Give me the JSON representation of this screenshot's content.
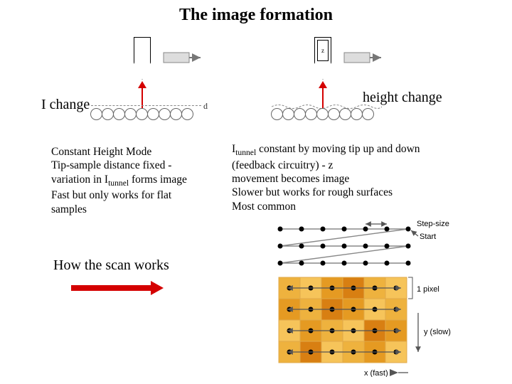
{
  "title": "The image formation",
  "labels": {
    "i_change": "I change",
    "height_change": "height change",
    "how_scan": "How the scan works",
    "d": "d",
    "z": "z",
    "step_size": "Step-size",
    "start": "Start",
    "one_pixel": "1 pixel",
    "y_slow": "y (slow)",
    "x_fast": "x (fast)"
  },
  "left_mode": {
    "line1": "Constant Height Mode",
    "line2": "Tip-sample distance fixed -",
    "line3_a": "variation in I",
    "line3_sub": "tunnel",
    "line3_b": " forms image",
    "line4": "Fast but only works for flat",
    "line5": "samples"
  },
  "right_mode": {
    "line1_a": "I",
    "line1_sub": "tunnel",
    "line1_b": " constant by moving tip up and down",
    "line2": "(feedback circuitry) - z",
    "line3": "movement becomes image",
    "line4": "Slower but works for rough surfaces",
    "line5": "Most common"
  }
}
